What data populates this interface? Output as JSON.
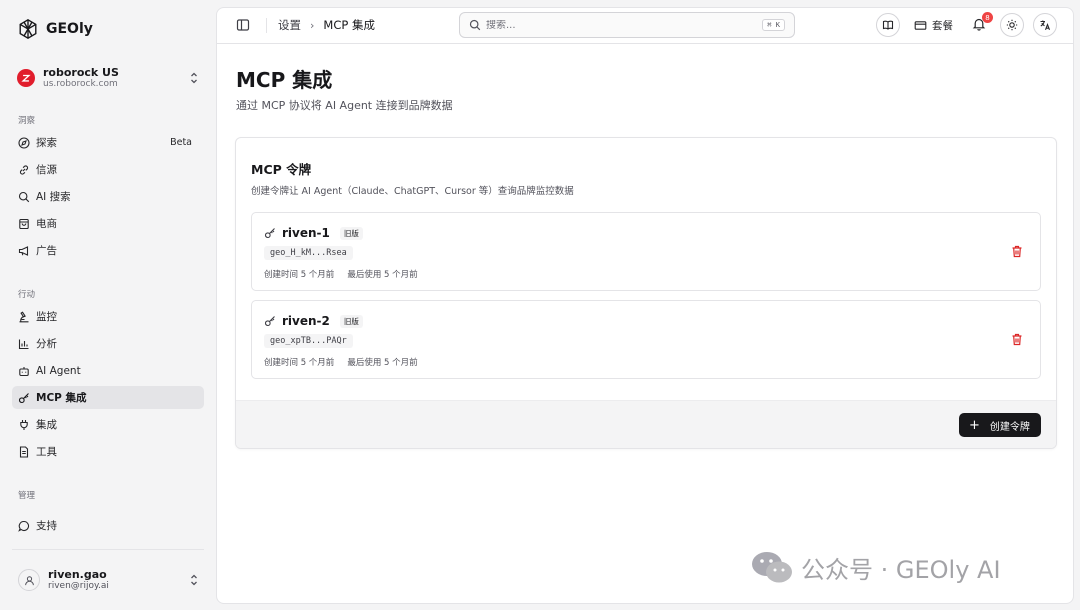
{
  "app": {
    "name": "GEOly"
  },
  "org": {
    "name": "roborock US",
    "domain": "us.roborock.com"
  },
  "sidebar": {
    "sections": [
      {
        "label": "洞察"
      },
      {
        "label": "行动"
      },
      {
        "label": "管理"
      }
    ],
    "items": [
      {
        "label": "探索",
        "badge": "Beta",
        "icon": "compass-icon"
      },
      {
        "label": "信源",
        "icon": "link-icon"
      },
      {
        "label": "AI 搜索",
        "icon": "search-icon"
      },
      {
        "label": "电商",
        "icon": "shopping-bag-icon"
      },
      {
        "label": "广告",
        "icon": "megaphone-icon"
      },
      {
        "label": "监控",
        "icon": "microscope-icon"
      },
      {
        "label": "分析",
        "icon": "bar-chart-icon"
      },
      {
        "label": "AI Agent",
        "icon": "bot-icon"
      },
      {
        "label": "MCP 集成",
        "icon": "key-icon",
        "active": true
      },
      {
        "label": "集成",
        "icon": "plug-icon"
      },
      {
        "label": "工具",
        "icon": "file-icon"
      },
      {
        "label": "支持",
        "icon": "message-circle-icon"
      }
    ]
  },
  "user": {
    "name": "riven.gao",
    "email": "riven@rijoy.ai"
  },
  "topbar": {
    "breadcrumb": [
      "设置",
      "MCP 集成"
    ],
    "search_placeholder": "搜索...",
    "search_shortcut": "⌘ K",
    "plan_label": "套餐",
    "notification_count": "8"
  },
  "page": {
    "title": "MCP 集成",
    "subtitle": "通过 MCP 协议将 AI Agent 连接到品牌数据"
  },
  "card": {
    "title": "MCP 令牌",
    "description": "创建令牌让 AI Agent（Claude、ChatGPT、Cursor 等）查询品牌监控数据",
    "tokens": [
      {
        "name": "riven-1",
        "tag": "旧版",
        "key": "geo_H_kM...Rsea",
        "created": "创建时间 5 个月前",
        "last_used": "最后使用 5 个月前"
      },
      {
        "name": "riven-2",
        "tag": "旧版",
        "key": "geo_xpTB...PAQr",
        "created": "创建时间 5 个月前",
        "last_used": "最后使用 5 个月前"
      }
    ],
    "create_label": "创建令牌"
  },
  "watermark": {
    "text": "公众号 · GEOly AI"
  },
  "colors": {
    "danger": "#dc2626",
    "primary": "#18181b",
    "org_brand": "#e11d2c"
  }
}
